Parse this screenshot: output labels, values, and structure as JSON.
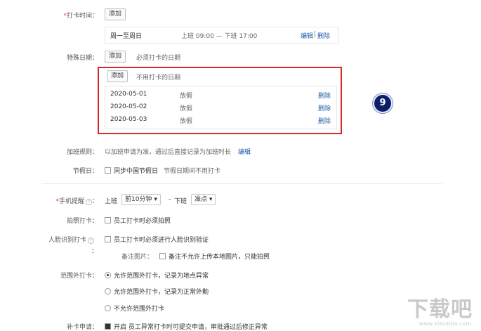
{
  "checkin_time": {
    "label": "打卡时间：",
    "add_button": "添加",
    "row": {
      "days": "周一至周日",
      "hours": "上班 09:00 — 下班 17:00",
      "edit": "编辑",
      "sep": "|",
      "delete": "删除"
    }
  },
  "special_dates": {
    "label": "特殊日期：",
    "required_add": "添加",
    "required_hint": "必须打卡的日期",
    "not_required_add": "添加",
    "not_required_hint": "不用打卡的日期",
    "rows": [
      {
        "date": "2020-05-01",
        "type": "放假",
        "action": "删除"
      },
      {
        "date": "2020-05-02",
        "type": "放假",
        "action": "删除"
      },
      {
        "date": "2020-05-03",
        "type": "放假",
        "action": "删除"
      }
    ],
    "badge": "9"
  },
  "overtime": {
    "label": "加班规则：",
    "text": "以加班申请为准，通过后直接记录为加班时长",
    "edit": "编辑"
  },
  "holiday": {
    "label": "节假日：",
    "checkbox": "同步中国节假日",
    "hint": "节假日期间不用打卡"
  },
  "reminder": {
    "label": "手机提醒",
    "start_label": "上班",
    "start_value": "前10分钟",
    "dash": "-",
    "end_label": "下班",
    "end_value": "准点"
  },
  "photo": {
    "label": "拍照打卡：",
    "option": "员工打卡时必须拍照"
  },
  "face": {
    "label": "人脸识别打卡",
    "colon": "：",
    "option": "员工打卡时必须进行人脸识别验证",
    "note_label": "备注图片：",
    "note_option": "备注不允许上传本地图片，只能拍照"
  },
  "range": {
    "label": "范围外打卡：",
    "options": [
      "允许范围外打卡，记录为地点异常",
      "允许范围外打卡，记录为正常外勤",
      "不允许范围外打卡"
    ]
  },
  "makeup": {
    "label": "补卡申请：",
    "text": "开启 员工异常打卡时可提交申请，审批通过后修正异常"
  },
  "watermark": {
    "logo": "下载吧",
    "url": "www.xiazaiba.com"
  },
  "colors": {
    "highlight": "#d52a2a",
    "link": "#1f5fa8",
    "badge": "#0c1f6b"
  }
}
